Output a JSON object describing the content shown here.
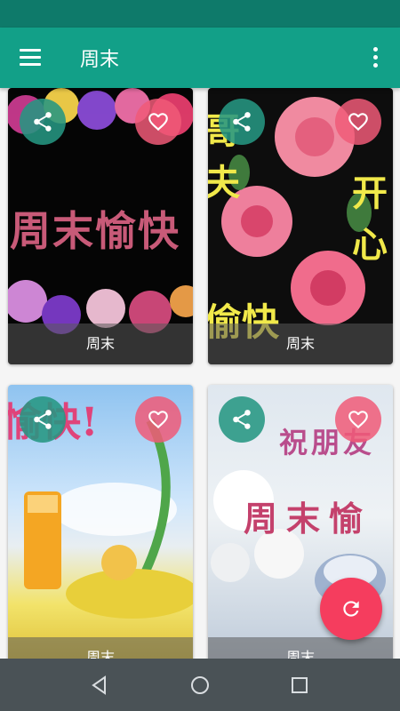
{
  "app_bar": {
    "title": "周末"
  },
  "cards": [
    {
      "caption": "周末",
      "art_text": "周末愉快"
    },
    {
      "caption": "周末",
      "art_text_left": "哥夫",
      "art_text_right": "开心",
      "art_text_bottom": "偷快"
    },
    {
      "caption": "周末",
      "art_text": "愉快!"
    },
    {
      "caption": "周末",
      "art_text_top": "祝朋友",
      "art_text_mid": "周末愉"
    }
  ],
  "icons": {
    "menu": "hamburger-icon",
    "overflow": "more-vert-icon",
    "share": "share-icon",
    "favorite": "heart-outline-icon",
    "refresh": "refresh-icon",
    "back": "back-triangle-icon",
    "home": "home-circle-icon",
    "recents": "recents-square-icon"
  },
  "colors": {
    "status_bar": "#0e7a6a",
    "app_bar": "#12a088",
    "fab": "#f53d5e",
    "nav_bar": "#4a5256"
  }
}
